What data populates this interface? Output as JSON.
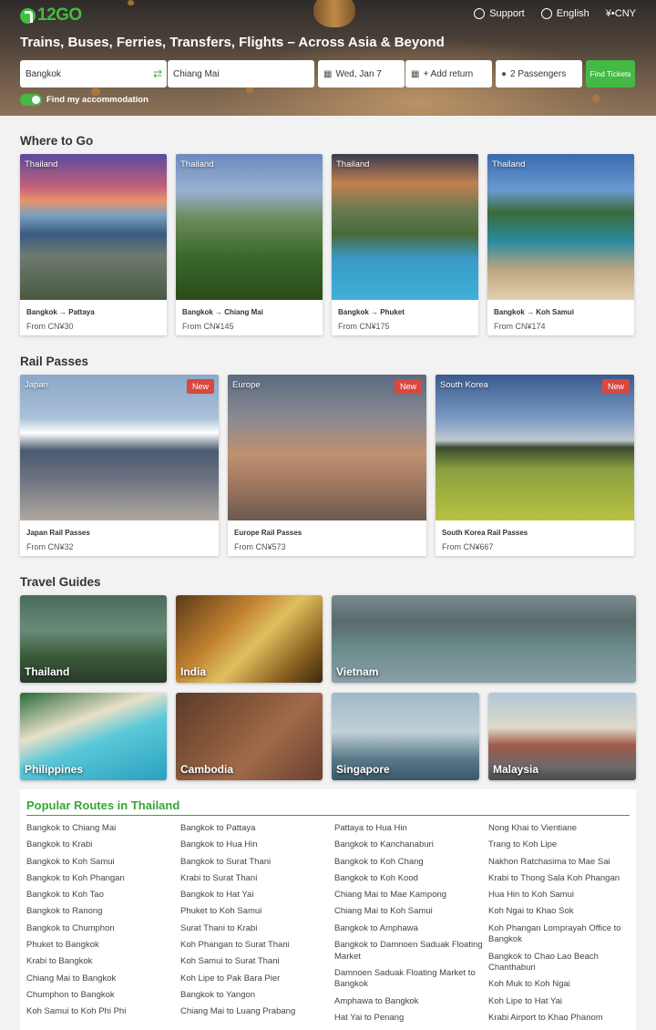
{
  "header": {
    "logo": "12GO",
    "links": [
      {
        "icon": "support-icon",
        "label": "Support"
      },
      {
        "icon": "globe-icon",
        "label": "English"
      },
      {
        "icon": "currency-icon",
        "label": "¥•CNY"
      }
    ],
    "title": "Trains, Buses, Ferries, Transfers, Flights – Across Asia & Beyond"
  },
  "search": {
    "from_value": "Bangkok",
    "to_value": "Chiang Mai",
    "date_value": "Wed, Jan 7",
    "return_label": "+ Add return",
    "passengers_label": "2 Passengers",
    "button_label": "Find Tickets",
    "accommodation_label": "Find my accommodation"
  },
  "where_to_go": {
    "title": "Where to Go",
    "cards": [
      {
        "tag": "Thailand",
        "title": "Bangkok → Pattaya",
        "price": "From CN¥30"
      },
      {
        "tag": "Thailand",
        "title": "Bangkok → Chiang Mai",
        "price": "From CN¥145"
      },
      {
        "tag": "Thailand",
        "title": "Bangkok → Phuket",
        "price": "From CN¥175"
      },
      {
        "tag": "Thailand",
        "title": "Bangkok → Koh Samui",
        "price": "From CN¥174"
      }
    ]
  },
  "rail_passes": {
    "title": "Rail Passes",
    "cards": [
      {
        "tag": "Japan",
        "badge": "New",
        "title": "Japan Rail Passes",
        "price": "From CN¥32"
      },
      {
        "tag": "Europe",
        "badge": "New",
        "title": "Europe Rail Passes",
        "price": "From CN¥573"
      },
      {
        "tag": "South Korea",
        "badge": "New",
        "title": "South Korea Rail Passes",
        "price": "From CN¥667"
      }
    ]
  },
  "travel_guides": {
    "title": "Travel Guides",
    "items": [
      "Thailand",
      "India",
      "Vietnam",
      "Philippines",
      "Cambodia",
      "Singapore",
      "Malaysia"
    ]
  },
  "popular_routes": {
    "title": "Popular Routes in Thailand",
    "columns": [
      [
        "Bangkok to Chiang Mai",
        "Bangkok to Krabi",
        "Bangkok to Koh Samui",
        "Bangkok to Koh Phangan",
        "Bangkok to Koh Tao",
        "Bangkok to Ranong",
        "Bangkok to Chumphon",
        "Phuket to Bangkok",
        "Krabi to Bangkok",
        "Chiang Mai to Bangkok",
        "Chumphon to Bangkok",
        "Koh Samui to Koh Phi Phi"
      ],
      [
        "Bangkok to Pattaya",
        "Bangkok to Hua Hin",
        "Bangkok to Surat Thani",
        "Krabi to Surat Thani",
        "Bangkok to Hat Yai",
        "Phuket to Koh Samui",
        "Surat Thani to Krabi",
        "Koh Phangan to Surat Thani",
        "Koh Samui to Surat Thani",
        "Koh Lipe to Pak Bara Pier",
        "Bangkok to Yangon",
        "Chiang Mai to Luang Prabang"
      ],
      [
        "Pattaya to Hua Hin",
        "Bangkok to Kanchanaburi",
        "Bangkok to Koh Chang",
        "Bangkok to Koh Kood",
        "Chiang Mai to Mae Kampong",
        "Chiang Mai to Koh Samui",
        "Bangkok to Amphawa",
        "Bangkok to Damnoen Saduak Floating Market",
        "Damnoen Saduak Floating Market to Bangkok",
        "Amphawa to Bangkok",
        "Hat Yai to Penang"
      ],
      [
        "Nong Khai to Vientiane",
        "Trang to Koh Lipe",
        "Nakhon Ratchasima to Mae Sai",
        "Krabi to Thong Sala Koh Phangan",
        "Hua Hin to Koh Samui",
        "Koh Ngai to Khao Sok",
        "Koh Phangan Lomprayah Office to Bangkok",
        "Bangkok to Chao Lao Beach Chanthaburi",
        "Koh Muk to Koh Ngai",
        "Koh Lipe to Hat Yai",
        "Krabi Airport to Khao Phanom"
      ]
    ]
  },
  "colors": {
    "brand_green": "#44b944",
    "badge_red": "#d9473e"
  }
}
